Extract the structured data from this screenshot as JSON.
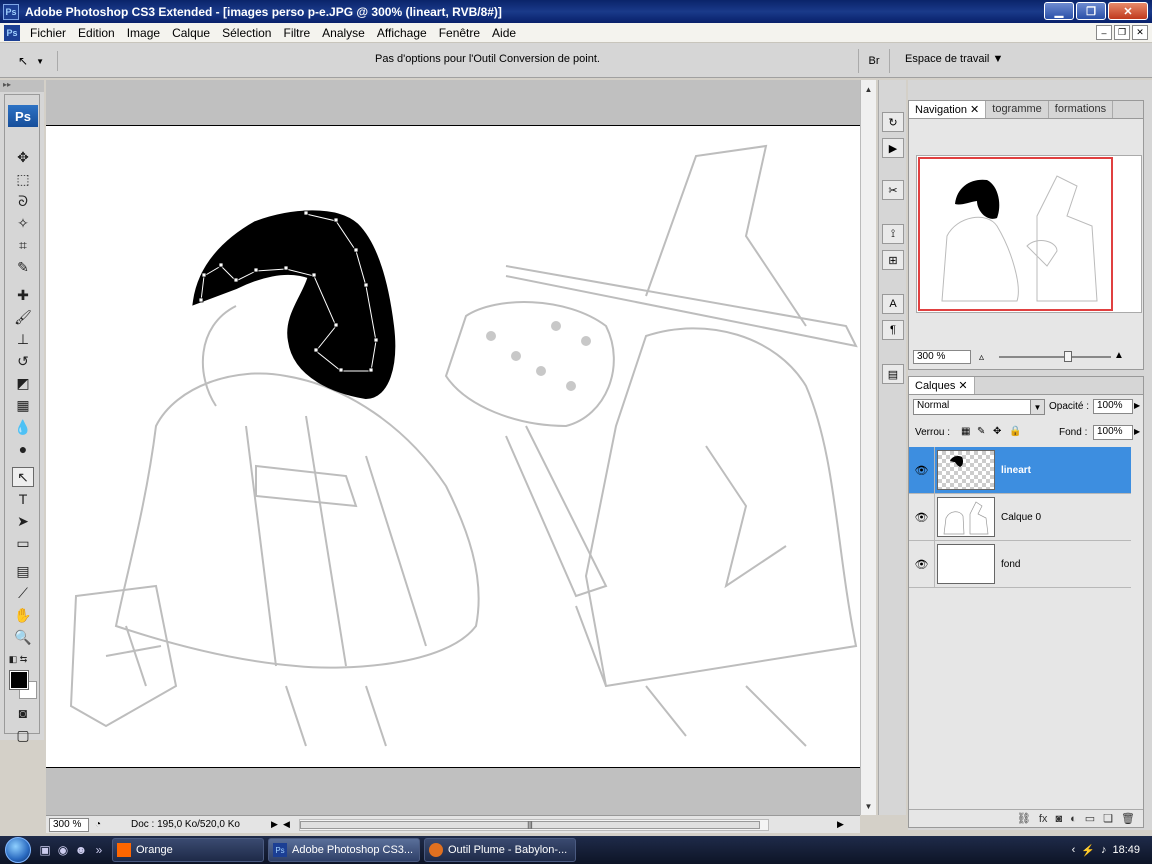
{
  "window": {
    "title": "Adobe Photoshop CS3 Extended - [images perso p-e.JPG @ 300% (lineart, RVB/8#)]",
    "app_icon": "Ps"
  },
  "menu": [
    "Fichier",
    "Edition",
    "Image",
    "Calque",
    "Sélection",
    "Filtre",
    "Analyse",
    "Affichage",
    "Fenêtre",
    "Aide"
  ],
  "options_bar": {
    "message": "Pas d'options pour l'Outil Conversion de point.",
    "workspace_label": "Espace de travail",
    "bridge_label": "Br"
  },
  "toolbox": {
    "logo": "Ps"
  },
  "status": {
    "zoom": "300 %",
    "doc_info": "Doc : 195,0 Ko/520,0 Ko"
  },
  "navigator": {
    "tabs": [
      "Navigation",
      "togramme",
      "formations"
    ],
    "zoom": "300 %"
  },
  "layers_panel": {
    "tab": "Calques",
    "blend_mode": "Normal",
    "opacity_label": "Opacité :",
    "opacity": "100%",
    "lock_label": "Verrou :",
    "fill_label": "Fond :",
    "fill": "100%",
    "layers": [
      {
        "name": "lineart",
        "selected": true
      },
      {
        "name": "Calque 0",
        "selected": false
      },
      {
        "name": "fond",
        "selected": false
      }
    ]
  },
  "taskbar": {
    "tasks": [
      "Orange",
      "Adobe Photoshop CS3...",
      "Outil Plume - Babylon-..."
    ],
    "clock": "18:49"
  },
  "colors": {
    "selection": "#3d8ee0",
    "nav_view_box": "#e04040"
  }
}
